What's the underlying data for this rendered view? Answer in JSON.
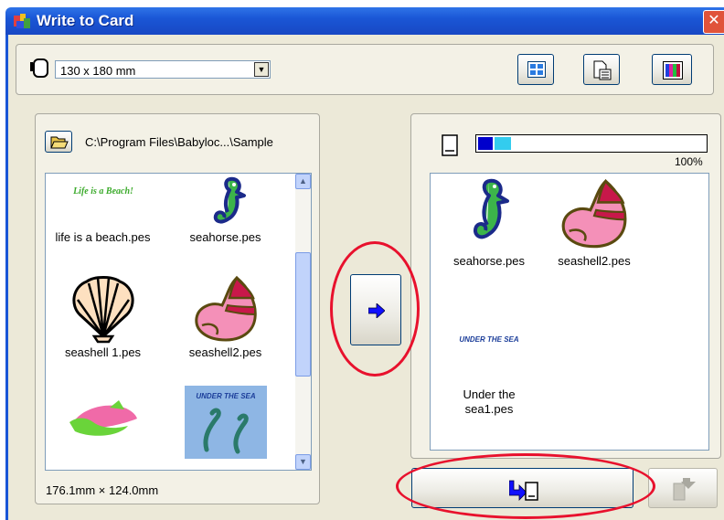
{
  "window": {
    "title": "Write to Card",
    "close_glyph": "✕"
  },
  "toolbar": {
    "hoop_size": "130 x 180 mm",
    "icons": [
      "hoop-icon",
      "layout-grid-icon",
      "properties-icon",
      "color-bars-icon"
    ]
  },
  "source": {
    "path": "C:\\Program Files\\Babyloc...\\Sample",
    "size_text": "176.1mm × 124.0mm",
    "items": [
      {
        "label": "life is a beach.pes",
        "art": "life-is-a-beach-thumbnail"
      },
      {
        "label": "seahorse.pes",
        "art": "seahorse-thumbnail"
      },
      {
        "label": "seashell 1.pes",
        "art": "scallop-shell-thumbnail"
      },
      {
        "label": "seashell2.pes",
        "art": "conch-shell-thumbnail"
      },
      {
        "label": "",
        "art": "green-pink-shell-thumbnail"
      },
      {
        "label": "",
        "art": "under-the-sea-thumbnail"
      }
    ]
  },
  "card": {
    "usage_percent": 100,
    "usage_text": "100%",
    "items": [
      {
        "label": "seahorse.pes",
        "art": "seahorse-thumbnail"
      },
      {
        "label": "seashell2.pes",
        "art": "conch-shell-thumbnail"
      },
      {
        "label": "Under the sea1.pes",
        "label_line1": "Under the",
        "label_line2": "sea1.pes",
        "art": "under-the-sea-text-thumbnail"
      }
    ]
  },
  "thumb_text": {
    "beach": "Life is a Beach!",
    "sea": "UNDER THE SEA"
  },
  "colors": {
    "title_bar": "#1a56d6",
    "highlight": "#e8112d",
    "progress_dark": "#0000cc",
    "progress_light": "#33ccee"
  }
}
